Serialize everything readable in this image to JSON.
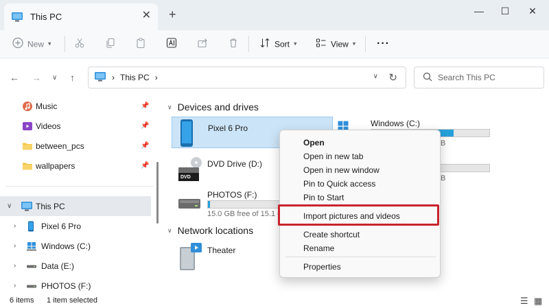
{
  "window": {
    "tab_title": "This PC",
    "close_tab_glyph": "✕",
    "new_tab_glyph": "+",
    "minimize_glyph": "—",
    "maximize_glyph": "☐",
    "close_glyph": "✕"
  },
  "toolbar": {
    "new_label": "New",
    "sort_label": "Sort",
    "view_label": "View",
    "more_glyph": "···"
  },
  "address": {
    "path_item": "This PC",
    "path_sep": "›",
    "search_placeholder": "Search This PC"
  },
  "sidebar": {
    "quick_access": [
      {
        "label": "Music",
        "icon": "music-icon"
      },
      {
        "label": "Videos",
        "icon": "videos-icon"
      },
      {
        "label": "between_pcs",
        "icon": "folder-icon"
      },
      {
        "label": "wallpapers",
        "icon": "folder-icon"
      }
    ],
    "this_pc": {
      "label": "This PC"
    },
    "devices": [
      {
        "label": "Pixel 6 Pro"
      },
      {
        "label": "Windows (C:)"
      },
      {
        "label": "Data (E:)"
      },
      {
        "label": "PHOTOS (F:)"
      }
    ]
  },
  "content": {
    "devices_header": "Devices and drives",
    "network_header": "Network locations",
    "tiles": {
      "pixel": {
        "name": "Pixel 6 Pro"
      },
      "windows": {
        "name": "Windows (C:)",
        "sub_partial": "B",
        "usage": 0.7
      },
      "dvd": {
        "name": "DVD Drive (D:)",
        "badge": "DVD"
      },
      "data_drive": {
        "sub_partial": "B",
        "usage": 0.0
      },
      "photos": {
        "name": "PHOTOS (F:)",
        "sub": "15.0 GB free of 15.1 G",
        "usage": 0.02
      },
      "theater": {
        "name": "Theater"
      }
    }
  },
  "context_menu": {
    "items": [
      "Open",
      "Open in new tab",
      "Open in new window",
      "Pin to Quick access",
      "Pin to Start",
      "Import pictures and videos",
      "Create shortcut",
      "Rename",
      "Properties"
    ]
  },
  "status": {
    "items_count": "6 items",
    "selected": "1 item selected"
  },
  "colors": {
    "accent": "#26a0da",
    "selection": "#cce4f7",
    "highlight_box": "#c8232c"
  }
}
